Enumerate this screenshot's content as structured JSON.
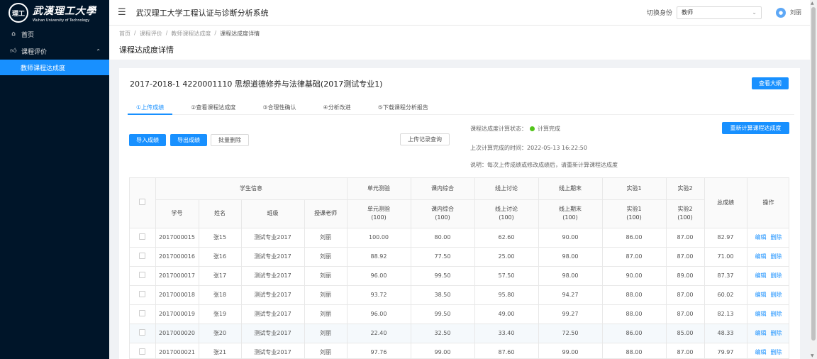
{
  "logo": {
    "cn": "武漢理工大學",
    "en": "Wuhan University of Technology",
    "emblem": "理工"
  },
  "sidebar": {
    "home": "首页",
    "course_eval": "课程评价",
    "sub_item": "教师课程达成度"
  },
  "header": {
    "title": "武汉理工大学工程认证与诊断分析系统",
    "switch_label": "切换身份",
    "role_value": "教师",
    "user": "刘丽"
  },
  "breadcrumb": [
    "首页",
    "课程评价",
    "教师课程达成度",
    "课程达成度详情"
  ],
  "page_title": "课程达成度详情",
  "course": {
    "title": "2017-2018-1 4220001110 思想道德修养与法律基础(2017测试专业1)",
    "outline_button": "查看大纲"
  },
  "tabs": [
    "①上传成绩",
    "②查看课程达成度",
    "③合理性确认",
    "④分析改进",
    "⑤下载课程分析报告"
  ],
  "actions": {
    "import": "导入成绩",
    "export": "导出成绩",
    "batch_delete": "批量删除",
    "upload_log": "上传记录查询",
    "recalc": "重新计算课程达成度"
  },
  "status": {
    "calc_label": "课程达成度计算状态：",
    "calc_value": "计算完成",
    "last_calc": "上次计算完成的时间：2022-05-13 16:22:50",
    "note": "说明：每次上传成绩或修改成绩后，请重新计算课程达成度"
  },
  "table": {
    "group_student": "学生信息",
    "groups": [
      "单元测验",
      "课内综合",
      "线上讨论",
      "线上期末",
      "实验1",
      "实验2"
    ],
    "total": "总成绩",
    "op": "操作",
    "sub_headers": [
      "学号",
      "姓名",
      "班级",
      "授课老师"
    ],
    "score_headers": [
      {
        "name": "单元测验",
        "full": "(100)"
      },
      {
        "name": "课内综合",
        "full": "(100)"
      },
      {
        "name": "线上讨论",
        "full": "(100)"
      },
      {
        "name": "线上期末",
        "full": "(100)"
      },
      {
        "name": "实验1",
        "full": "(100)"
      },
      {
        "name": "实验2",
        "full": "(100)"
      }
    ],
    "edit": "编辑",
    "delete": "删除",
    "rows": [
      [
        "2017000015",
        "张15",
        "测试专业2017",
        "刘丽",
        "100.00",
        "80.00",
        "62.60",
        "90.00",
        "86.00",
        "87.00",
        "82.97"
      ],
      [
        "2017000016",
        "张16",
        "测试专业2017",
        "刘丽",
        "88.92",
        "77.50",
        "25.00",
        "98.00",
        "87.00",
        "87.00",
        "71.00"
      ],
      [
        "2017000017",
        "张17",
        "测试专业2017",
        "刘丽",
        "96.00",
        "99.50",
        "57.50",
        "98.00",
        "90.00",
        "89.00",
        "87.37"
      ],
      [
        "2017000018",
        "张18",
        "测试专业2017",
        "刘丽",
        "93.72",
        "38.50",
        "95.80",
        "94.27",
        "88.00",
        "87.00",
        "60.02"
      ],
      [
        "2017000019",
        "张19",
        "测试专业2017",
        "刘丽",
        "96.00",
        "99.50",
        "49.00",
        "99.27",
        "88.00",
        "87.00",
        "82.13"
      ],
      [
        "2017000020",
        "张20",
        "测试专业2017",
        "刘丽",
        "22.40",
        "32.50",
        "33.40",
        "72.50",
        "86.00",
        "85.00",
        "48.33"
      ],
      [
        "2017000021",
        "张21",
        "测试专业2017",
        "刘丽",
        "97.76",
        "99.00",
        "87.60",
        "99.00",
        "88.00",
        "87.00",
        "79.97"
      ]
    ]
  }
}
